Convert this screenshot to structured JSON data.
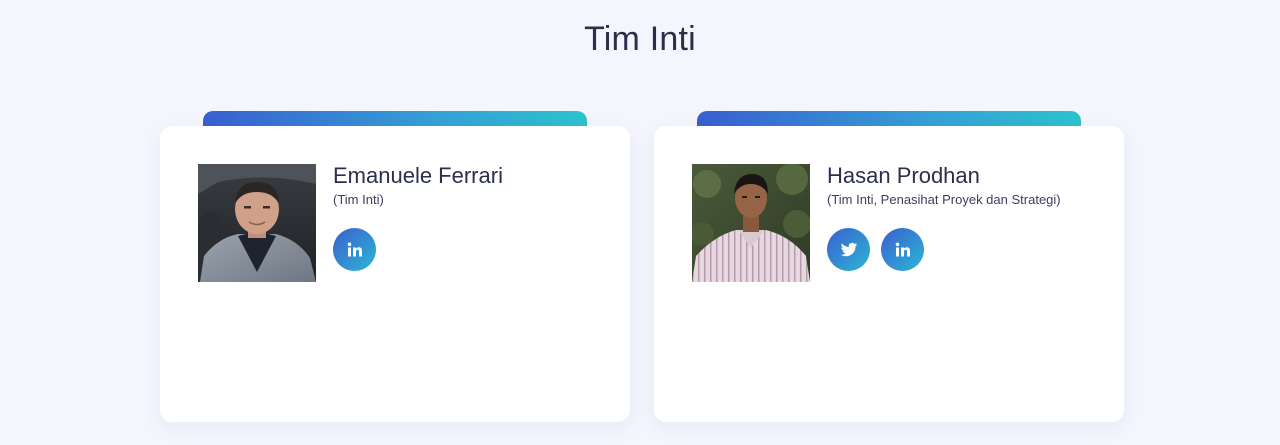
{
  "section": {
    "title": "Tim Inti"
  },
  "colors": {
    "background": "#f4f5fd",
    "accent_start": "#3a5fd0",
    "accent_end": "#2cc2cf",
    "text": "#2b2f4c"
  },
  "members": [
    {
      "name": "Emanuele Ferrari",
      "role": "(Tim Inti)",
      "photo": "portrait-photo",
      "socials": [
        {
          "network": "linkedin",
          "icon": "linkedin-icon",
          "label": "in"
        }
      ]
    },
    {
      "name": "Hasan Prodhan",
      "role": "(Tim Inti, Penasihat Proyek dan Strategi)",
      "photo": "portrait-photo",
      "socials": [
        {
          "network": "twitter",
          "icon": "twitter-icon"
        },
        {
          "network": "linkedin",
          "icon": "linkedin-icon",
          "label": "in"
        }
      ]
    }
  ]
}
